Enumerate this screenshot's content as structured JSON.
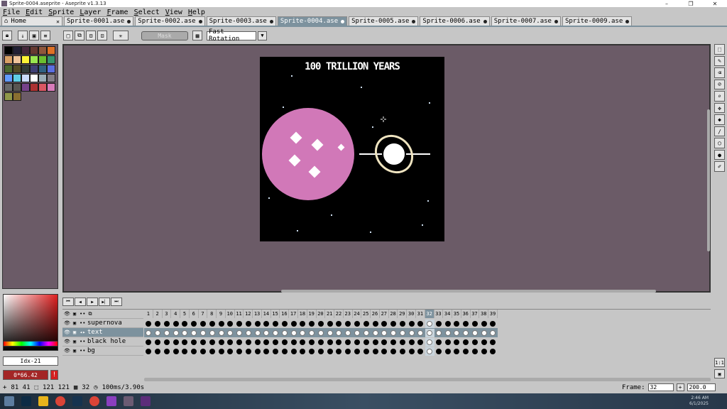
{
  "window": {
    "title": "Sprite-0004.aseprite - Aseprite v1.3.13",
    "controls": [
      "–",
      "❐",
      "✕"
    ]
  },
  "menu": [
    "File",
    "Edit",
    "Sprite",
    "Layer",
    "Frame",
    "Select",
    "View",
    "Help"
  ],
  "tabs": [
    {
      "label": "Home",
      "active": false
    },
    {
      "label": "Sprite-0001.ase",
      "active": false
    },
    {
      "label": "Sprite-0002.ase",
      "active": false
    },
    {
      "label": "Sprite-0003.ase",
      "active": false
    },
    {
      "label": "Sprite-0004.ase",
      "active": true
    },
    {
      "label": "Sprite-0005.ase",
      "active": false
    },
    {
      "label": "Sprite-0006.ase",
      "active": false
    },
    {
      "label": "Sprite-0007.ase",
      "active": false
    },
    {
      "label": "Sprite-0009.ase",
      "active": false
    }
  ],
  "toolbar": {
    "mask_label": "Mask",
    "rotation_value": "Fast Rotation"
  },
  "palette_colors": [
    "#000000",
    "#222034",
    "#45283c",
    "#663931",
    "#8f563b",
    "#df7126",
    "#d9a066",
    "#eec39a",
    "#fbf236",
    "#99e550",
    "#6abe30",
    "#37946e",
    "#4b692f",
    "#524b24",
    "#323c39",
    "#3f3f74",
    "#306082",
    "#5b6ee1",
    "#639bff",
    "#5fcde4",
    "#cbdbfc",
    "#ffffff",
    "#9badb7",
    "#847e87",
    "#696a6a",
    "#595652",
    "#76428a",
    "#ac3232",
    "#d95763",
    "#d77bba",
    "#8f974a",
    "#8a6f30"
  ],
  "sprite": {
    "title": "100 TRILLION YEARS"
  },
  "color": {
    "index_label": "Idx-21",
    "hex_value": "0*66.42"
  },
  "layers": [
    "supernova",
    "text",
    "black hole",
    "bg"
  ],
  "active_layer": "text",
  "frames_count": 39,
  "current_frame": 32,
  "status": {
    "pos": "81 41",
    "size": "121 121",
    "frame": "32",
    "duration": "100ms/3.90s"
  },
  "frame_ctl": {
    "label": "Frame:",
    "frame_value": "32",
    "zoom_value": "200.0"
  },
  "taskbar_clock": {
    "time": "2:46 AM",
    "date": "6/1/2025"
  }
}
